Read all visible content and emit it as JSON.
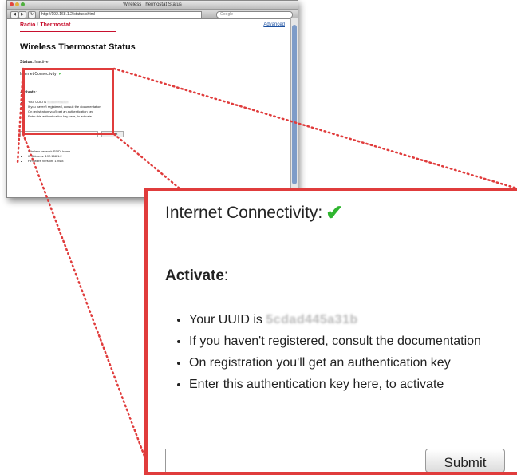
{
  "browser": {
    "window_title": "Wireless Thermostat Status",
    "url": "http://192.168.1.2/status.shtml",
    "search_placeholder": "Google",
    "back_label": "◀",
    "forward_label": "▶",
    "refresh_label": "↻"
  },
  "page": {
    "logo_left": "Radio",
    "logo_right": "Thermostat",
    "advanced_link": "Advanced",
    "title": "Wireless Thermostat Status",
    "status_label": "Status:",
    "status_value": "Inactive",
    "connectivity_label": "Internet Connectivity:",
    "check_glyph": "✔",
    "activate_label": "Activate",
    "activate_colon": ":",
    "uuid_prefix": "Your UUID is",
    "uuid_value": "5cdad445a31b",
    "bullets": [
      "If you haven't registered, consult the documentation",
      "On registration you'll get an authentication key",
      "Enter this authentication key here, to activate"
    ],
    "submit_label": "Submit",
    "info": [
      "Wireless network SSID: home",
      "IP Address: 192.168.1.2",
      "Firmware Version: 1.94.8"
    ]
  },
  "colors": {
    "highlight": "#e03c3c",
    "brand_red": "#c8102e",
    "check_green": "#2fb52f"
  }
}
